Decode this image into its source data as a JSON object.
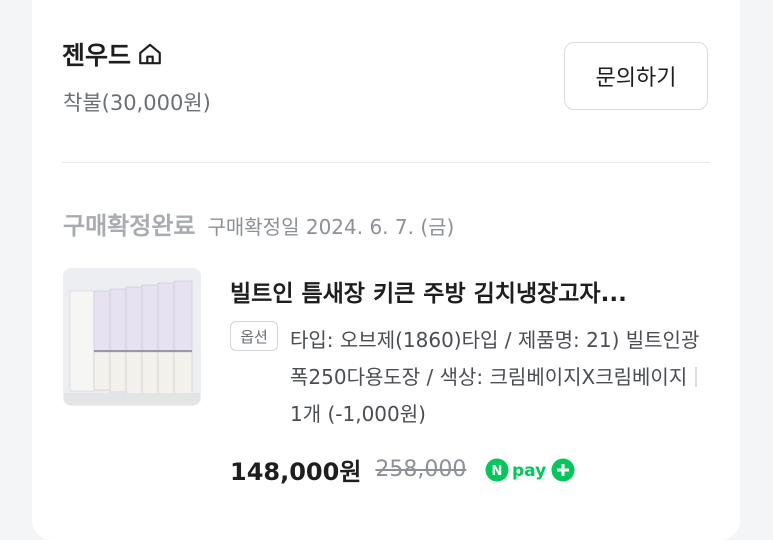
{
  "seller": {
    "name": "젠우드",
    "home_icon": "home-icon",
    "shipping": "착불(30,000원)",
    "inquiry_label": "문의하기"
  },
  "order": {
    "status": "구매확정완료",
    "confirm_date": "구매확정일 2024. 6. 7. (금)"
  },
  "product": {
    "title": "빌트인 틈새장 키큰 주방 김치냉장고자...",
    "option_badge": "옵션",
    "option_text": "타입: 오브제(1860)타입 / 제품명: 21) 빌트인광폭250다용도장 / 색상: 크림베이지X크림베이지",
    "quantity": "1개 (-1,000원)",
    "price": "148,000원",
    "original_price": "258,000",
    "npay_label": "pay",
    "npay_n": "N",
    "npay_plus": "+"
  },
  "colors": {
    "npay_green": "#03c75a",
    "status_gray": "#a8acb2",
    "text": "#1e1e1e"
  }
}
